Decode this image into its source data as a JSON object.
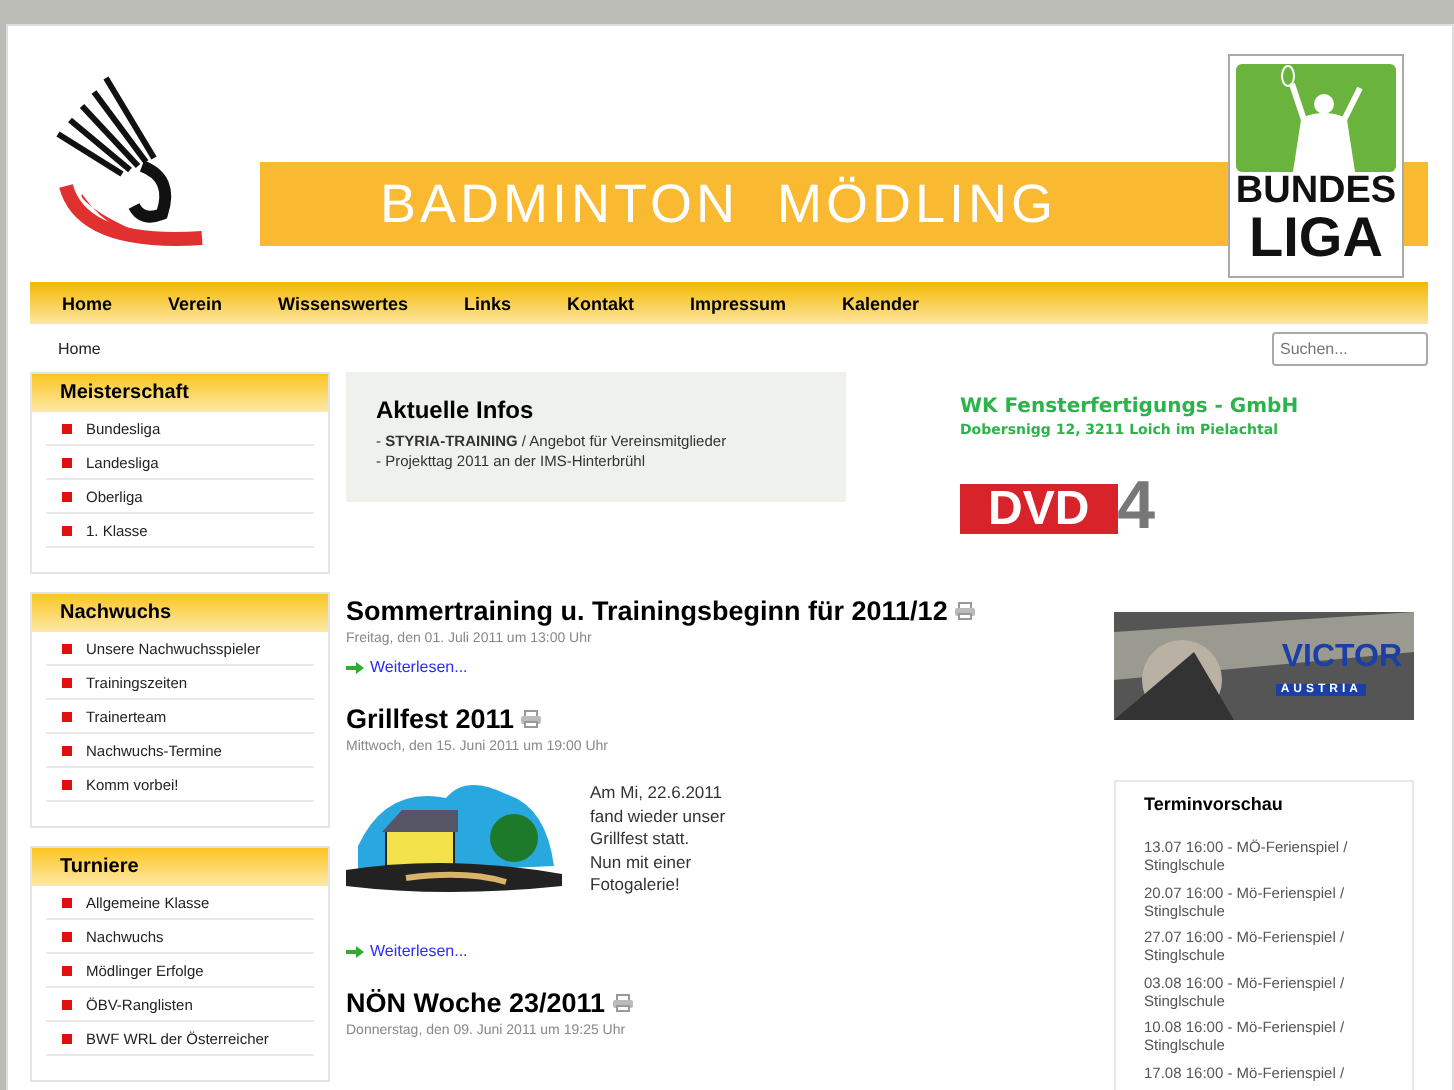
{
  "header": {
    "title": "BADMINTON  MÖDLING",
    "league_logo": [
      "BUNDES",
      "LIGA"
    ]
  },
  "nav": [
    {
      "label": "Home"
    },
    {
      "label": "Verein"
    },
    {
      "label": "Wissenswertes"
    },
    {
      "label": "Links"
    },
    {
      "label": "Kontakt"
    },
    {
      "label": "Impressum"
    },
    {
      "label": "Kalender"
    }
  ],
  "breadcrumb": "Home",
  "search": {
    "placeholder": "Suchen..."
  },
  "sidebar": [
    {
      "title": "Meisterschaft",
      "items": [
        "Bundesliga",
        "Landesliga",
        "Oberliga",
        "1. Klasse"
      ]
    },
    {
      "title": "Nachwuchs",
      "items": [
        "Unsere Nachwuchsspieler",
        "Trainingszeiten",
        "Trainerteam",
        "Nachwuchs-Termine",
        "Komm vorbei!"
      ]
    },
    {
      "title": "Turniere",
      "items": [
        "Allgemeine Klasse",
        "Nachwuchs",
        "Mödlinger Erfolge",
        "ÖBV-Ranglisten",
        "BWF WRL der Österreicher"
      ]
    }
  ],
  "infos": {
    "title": "Aktuelle Infos",
    "items": [
      "- **STYRIA-TRAINING** / Angebot für Vereinsmitglieder",
      "- Projekttag 2011 an der IMS-Hinterbrühl"
    ]
  },
  "ads": {
    "company": "WK Fensterfertigungs - GmbH",
    "address": "Dobersnigg 12, 3211 Loich im Pielachtal",
    "dvd": "DVD",
    "dvd_number": "4",
    "victor": "VICTOR",
    "victor_sub": "AUSTRIA"
  },
  "articles": [
    {
      "title": "Sommertraining u. Trainingsbeginn für 2011/12",
      "date": "Freitag, den 01. Juli 2011 um 13:00 Uhr",
      "more": "Weiterlesen..."
    },
    {
      "title": "Grillfest 2011",
      "date": "Mittwoch, den 15. Juni 2011 um 19:00 Uhr",
      "image": {
        "kind": "picture"
      },
      "text": [
        "Am Mi, 22.6.2011",
        "fand wieder unser",
        "Grillfest statt.",
        "Nun mit einer",
        "Fotogalerie!"
      ],
      "more": "Weiterlesen..."
    },
    {
      "title": "NÖN Woche 23/2011",
      "date": "Donnerstag, den 09. Juni 2011 um 19:25 Uhr"
    }
  ],
  "events": {
    "title": "Terminvorschau",
    "items": [
      [
        "13.07 16:00 - MÖ-Ferienspiel /",
        "Stinglschule"
      ],
      [
        "20.07 16:00 - Mö-Ferienspiel /",
        "Stinglschule"
      ],
      [
        "27.07 16:00 - Mö-Ferienspiel /",
        "Stinglschule"
      ],
      [
        "03.08 16:00 - Mö-Ferienspiel /",
        "Stinglschule"
      ],
      [
        "10.08 16:00 - Mö-Ferienspiel /",
        "Stinglschule"
      ],
      [
        "17.08 16:00 - Mö-Ferienspiel /"
      ]
    ]
  }
}
